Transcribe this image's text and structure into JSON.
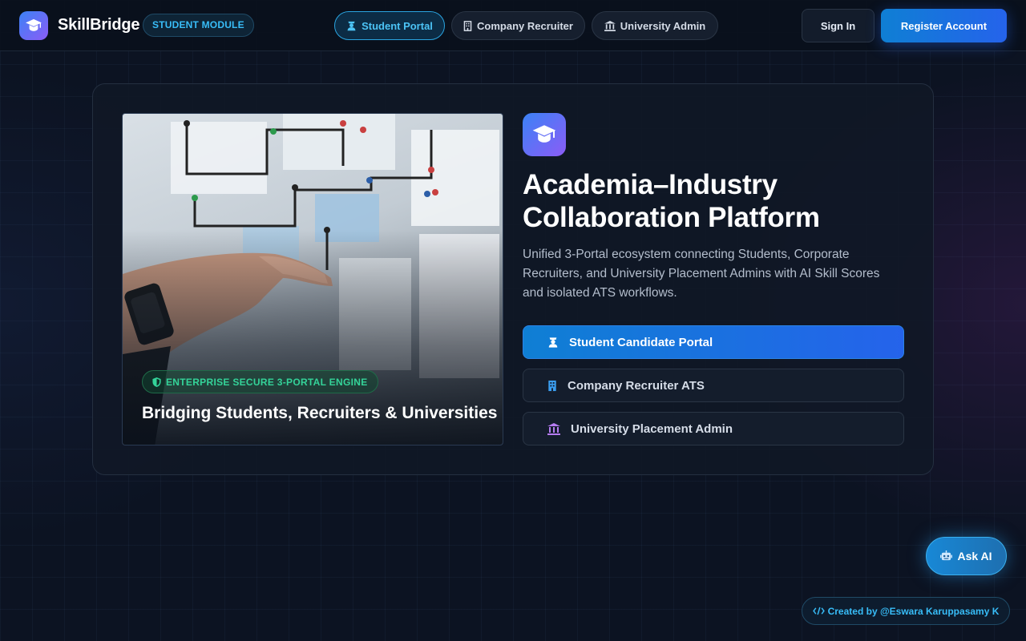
{
  "header": {
    "brand": "SkillBridge",
    "module_badge": "STUDENT MODULE",
    "tabs": [
      {
        "label": "Student Portal",
        "icon": "student-icon",
        "active": true
      },
      {
        "label": "Company Recruiter",
        "icon": "building-icon",
        "active": false
      },
      {
        "label": "University Admin",
        "icon": "university-icon",
        "active": false
      }
    ],
    "sign_in": "Sign In",
    "register": "Register Account"
  },
  "hero": {
    "badge": "ENTERPRISE SECURE 3-PORTAL ENGINE",
    "caption": "Bridging Students, Recruiters & Universities",
    "headline_line1": "Academia–Industry",
    "headline_line2": "Collaboration Platform",
    "description": "Unified 3-Portal ecosystem connecting Students, Corporate Recruiters, and University Placement Admins with AI Skill Scores and isolated ATS workflows.",
    "portals": [
      {
        "label": "Student Candidate Portal",
        "icon": "student-icon",
        "primary": true
      },
      {
        "label": "Company Recruiter ATS",
        "icon": "building-icon",
        "primary": false
      },
      {
        "label": "University Placement Admin",
        "icon": "university-icon",
        "primary": false
      }
    ]
  },
  "floating": {
    "ask_ai": "Ask AI",
    "credit": "Created by @Eswara Karuppasamy K"
  },
  "colors": {
    "accent": "#2563eb",
    "accent_cyan": "#38bdf8",
    "success": "#34d399",
    "background": "#0c1322"
  }
}
